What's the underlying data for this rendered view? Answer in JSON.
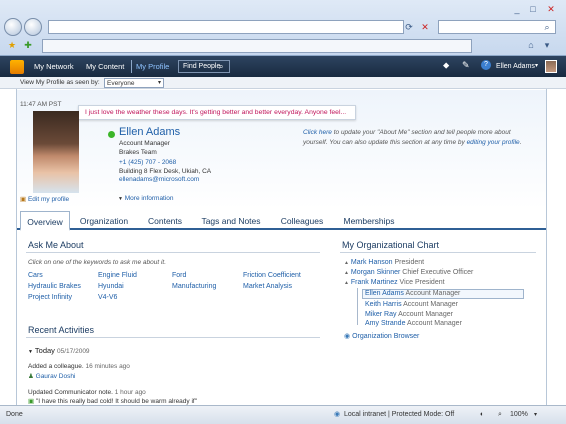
{
  "browser": {
    "search_icon": "search-icon",
    "home_icon": "home-icon",
    "status_left": "Done",
    "zone": "Local intranet | Protected Mode: Off",
    "zoom": "100%"
  },
  "nav": {
    "items": [
      "My Network",
      "My Content",
      "My Profile"
    ],
    "find_people": "Find People",
    "user": "Ellen Adams"
  },
  "view_as": {
    "label": "View My Profile as seen by:",
    "value": "Everyone"
  },
  "status_update": {
    "time": "11:47 AM PST",
    "text": "I just love the weather these days. It's getting better and better everyday. Anyone feel..."
  },
  "profile": {
    "name": "Ellen Adams",
    "title": "Account Manager",
    "team": "Brakes Team",
    "phone": "+1 (425) 707 - 2068",
    "location": "Building 8 Flex Desk, Ukiah, CA",
    "email": "ellenadams@microsoft.com",
    "edit_link": "Edit my profile",
    "more_info": "More information",
    "about_click": "Click here",
    "about_text1": " to update your \"About Me\" section and tell people more about yourself. You can also update this section at any time by ",
    "about_edit": "editing your profile",
    "about_end": "."
  },
  "tabs": [
    "Overview",
    "Organization",
    "Contents",
    "Tags and Notes",
    "Colleagues",
    "Memberships"
  ],
  "ask_me": {
    "title": "Ask Me About",
    "hint": "Click on one of the keywords to ask me about it.",
    "rows": [
      [
        "Cars",
        "Engine Fluid",
        "Ford",
        "Friction Coefficient"
      ],
      [
        "Hydraulic Brakes",
        "Hyundai",
        "Manufacturing",
        "Market Analysis"
      ],
      [
        "Project Infinity",
        "V4-V6",
        "",
        ""
      ]
    ]
  },
  "activities": {
    "title": "Recent Activities",
    "today": "Today",
    "date": "05/17/2009",
    "item1": "Added a colleague.",
    "item1_time": "16 minutes ago",
    "item1_person": "Gaurav Doshi",
    "item2": "Updated Communicator note.",
    "item2_time": "1 hour ago",
    "item2_quote": "\"I have this really bad cold! It should be warm already if\""
  },
  "org_chart": {
    "title": "My Organizational Chart",
    "chain": [
      {
        "name": "Mark Hanson",
        "role": "President"
      },
      {
        "name": "Morgan Skinner",
        "role": "Chief Executive Officer"
      },
      {
        "name": "Frank Martinez",
        "role": "Vice President"
      }
    ],
    "peers": [
      {
        "name": "Ellen Adams",
        "role": "Account Manager"
      },
      {
        "name": "Keith Harris",
        "role": "Account Manager"
      },
      {
        "name": "Miker Ray",
        "role": "Account Manager"
      },
      {
        "name": "Amy Strande",
        "role": "Account Manager"
      }
    ],
    "browser_link": "Organization Browser"
  }
}
